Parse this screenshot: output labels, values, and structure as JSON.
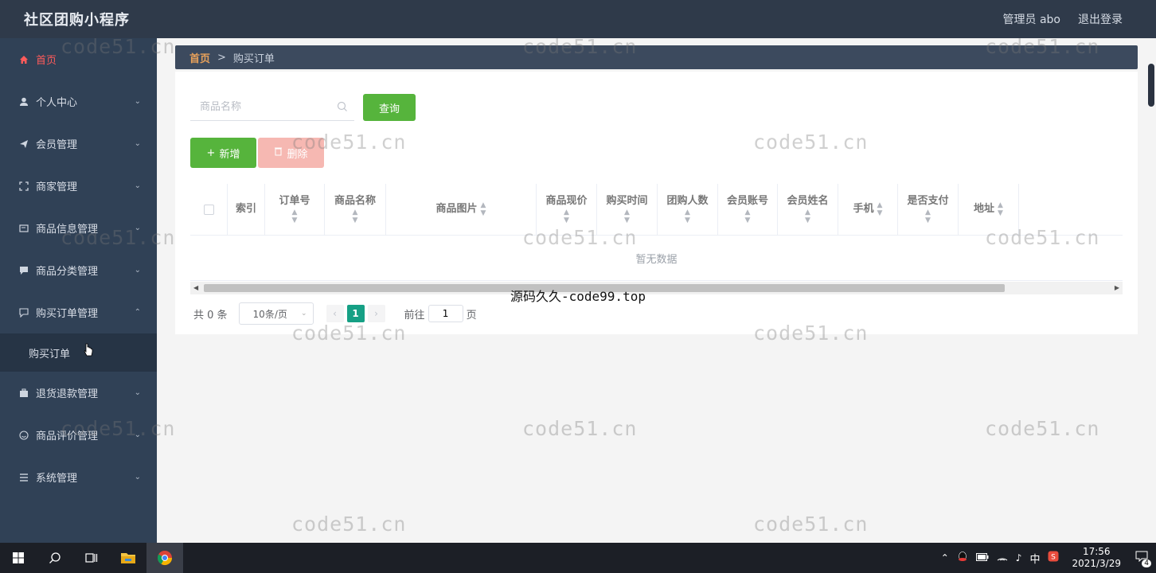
{
  "app": {
    "title": "社区团购小程序",
    "user_label": "管理员 abo",
    "logout_label": "退出登录"
  },
  "sidebar": {
    "items": [
      {
        "label": "首页",
        "icon": "home-icon"
      },
      {
        "label": "个人中心",
        "icon": "user-icon"
      },
      {
        "label": "会员管理",
        "icon": "send-icon"
      },
      {
        "label": "商家管理",
        "icon": "frame-icon"
      },
      {
        "label": "商品信息管理",
        "icon": "card-icon"
      },
      {
        "label": "商品分类管理",
        "icon": "chat-icon"
      },
      {
        "label": "购买订单管理",
        "icon": "message-icon"
      },
      {
        "label": "退货退款管理",
        "icon": "briefcase-icon"
      },
      {
        "label": "商品评价管理",
        "icon": "smile-icon"
      },
      {
        "label": "系统管理",
        "icon": "list-icon"
      }
    ],
    "sub_item": "购买订单"
  },
  "breadcrumb": {
    "home": "首页",
    "separator": ">",
    "current": "购买订单"
  },
  "search": {
    "placeholder": "商品名称",
    "query_label": "查询"
  },
  "actions": {
    "add_label": "新增",
    "delete_label": "删除"
  },
  "table": {
    "columns": [
      "索引",
      "订单号",
      "商品名称",
      "商品图片",
      "商品现价",
      "购买时间",
      "团购人数",
      "会员账号",
      "会员姓名",
      "手机",
      "是否支付",
      "地址"
    ],
    "empty_text": "暂无数据"
  },
  "pagination": {
    "total_label": "共 0 条",
    "page_size": "10条/页",
    "current_page": "1",
    "goto_label": "前往",
    "goto_value": "1",
    "page_suffix": "页"
  },
  "watermarks": {
    "text": "code51.cn",
    "overlay": "源码久久-code99.top"
  },
  "taskbar": {
    "time": "17:56",
    "date": "2021/3/29",
    "ime": "中",
    "notification_count": "4"
  },
  "colors": {
    "sidebar_bg": "#304156",
    "topbar_bg": "#2f3a4a",
    "active_menu": "#ff5b5b",
    "primary_green": "#56b43c",
    "danger_light": "#f6b8b2",
    "pager_active": "#16a085"
  }
}
